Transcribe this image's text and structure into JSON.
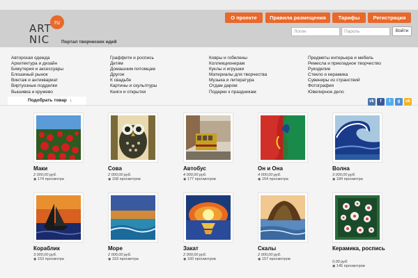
{
  "header": {
    "logo_line1": "ART",
    "logo_line2": "NIC",
    "logo_badge": "ru",
    "tagline": "Портал творческих идей",
    "nav": [
      "О проекте",
      "Правила размещения",
      "Тарифы",
      "Регистрация"
    ],
    "login_placeholder": "Логин",
    "password_placeholder": "Пароль",
    "login_button": "Войти"
  },
  "categories": {
    "col1": [
      "Авторская одежда",
      "Архитектура и дизайн",
      "Бижутерия и аксессуары",
      "Блошиный рынок",
      "Винтаж и антиквариат",
      "Виртуозные подделки",
      "Вышивка и кружево"
    ],
    "col2": [
      "Граффити и роспись",
      "Детям",
      "Домашним питомцам",
      "Другое",
      "К свадьбе",
      "Картины и скульптуры",
      "Книги и открытки"
    ],
    "col3": [
      "Ковры и гобелены",
      "Коллекционерам",
      "Куклы и игрушки",
      "Материалы для творчества",
      "Музыка и литература",
      "Отдам даром",
      "Подарки к праздникам"
    ],
    "col4": [
      "Предметы интерьера и мебель",
      "Ремесла и прикладное творчество",
      "Рукоделие",
      "Стекло и керамика",
      "Сувениры из странствий",
      "Фотография",
      "Ювелирное дело"
    ]
  },
  "filter": {
    "label": "Подобрать товар",
    "arrow": "↓"
  },
  "social": {
    "icons": [
      "vk",
      "f",
      "t",
      "g",
      "s",
      "ok"
    ],
    "colors": [
      "#4a76a8",
      "#3b5998",
      "#55acee",
      "#4a90d9",
      "#38a1f3",
      "#f2b41f"
    ]
  },
  "products": [
    {
      "title": "Маки",
      "price": "2 000,00 руб.",
      "views": "174 просмотра"
    },
    {
      "title": "Сова",
      "price": "2 000,00 руб.",
      "views": "158 просмотров"
    },
    {
      "title": "Автобус",
      "price": "4 000,00 руб.",
      "views": "177 просмотров"
    },
    {
      "title": "Он и Она",
      "price": "4 000,00 руб.",
      "views": "154 просмотра"
    },
    {
      "title": "Волна",
      "price": "3 000,00 руб.",
      "views": "184 просмотра"
    },
    {
      "title": "Кораблик",
      "price": "3 000,00 руб.",
      "views": "153 просмотра"
    },
    {
      "title": "Море",
      "price": "2 000,00 руб.",
      "views": "153 просмотра"
    },
    {
      "title": "Закат",
      "price": "2 000,00 руб.",
      "views": "160 просмотров"
    },
    {
      "title": "Скалы",
      "price": "2 000,00 руб.",
      "views": "157 просмотров"
    },
    {
      "title": "Керамика, роспись",
      "price": "0,00 руб.",
      "views": "145 просмотров"
    }
  ]
}
